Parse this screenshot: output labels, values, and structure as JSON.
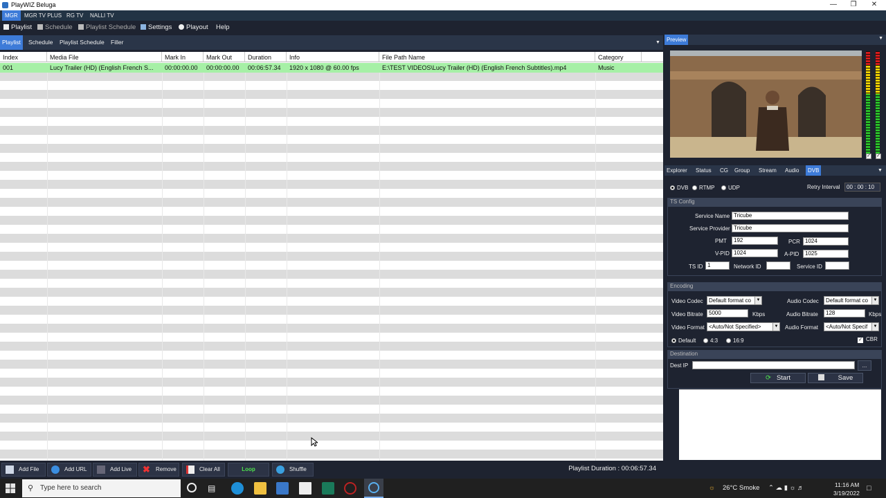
{
  "window": {
    "title": "PlayWIZ Beluga"
  },
  "channel_tabs": [
    "MGR",
    "MGR TV PLUS",
    "RG TV",
    "NALLI TV"
  ],
  "menu": {
    "items": [
      {
        "label": "Playlist"
      },
      {
        "label": "Schedule"
      },
      {
        "label": "Playlist Schedule"
      },
      {
        "label": "Settings"
      },
      {
        "label": "Playout"
      },
      {
        "label": "Help"
      }
    ]
  },
  "left_tabs": [
    "Playlist",
    "Schedule",
    "Playlist Schedule",
    "Filler"
  ],
  "playlist": {
    "columns": [
      "Index",
      "Media File",
      "Mark In",
      "Mark Out",
      "Duration",
      "Info",
      "File Path Name",
      "Category"
    ],
    "rows": [
      {
        "index": "001",
        "media_file": "Lucy Trailer (HD) (English French S...",
        "mark_in": "00:00:00.00",
        "mark_out": "00:00:00.00",
        "duration": "00:06:57.34",
        "info": "1920 x 1080 @ 60.00 fps",
        "path": "E:\\TEST VIDEOS\\Lucy Trailer (HD) (English French Subtitles).mp4",
        "category": "Music"
      }
    ]
  },
  "bottom_bar": {
    "buttons": [
      "Add File",
      "Add URL",
      "Add Live",
      "Remove",
      "Clear All",
      "Loop",
      "Shuffle"
    ],
    "duration_label": "Playlist Duration : 00:06:57.34"
  },
  "preview": {
    "label": "Preview"
  },
  "right_tabs": [
    "Explorer",
    "Status",
    "CG",
    "Group",
    "Stream",
    "Audio",
    "DVB"
  ],
  "dvb": {
    "modes": [
      "DVB",
      "RTMP",
      "UDP"
    ],
    "retry_label": "Retry Interval",
    "retry_value": "00 : 00 : 10",
    "ts_config": {
      "title": "TS Config",
      "service_name_label": "Service Name",
      "service_name": "Tricube",
      "service_provider_label": "Service Provider",
      "service_provider": "Tricube",
      "pmt_label": "PMT",
      "pmt": "192",
      "pcr_label": "PCR",
      "pcr": "1024",
      "vpid_label": "V-PID",
      "vpid": "1024",
      "apid_label": "A-PID",
      "apid": "1025",
      "tsid_label": "TS ID",
      "tsid": "1",
      "network_id_label": "Network ID",
      "network_id": "",
      "service_id_label": "Service ID",
      "service_id": ""
    },
    "encoding": {
      "title": "Encoding",
      "video_codec_label": "Video Codec",
      "video_codec": "Default format co",
      "audio_codec_label": "Audio Codec",
      "audio_codec": "Default format co",
      "video_bitrate_label": "Video Bitrate",
      "video_bitrate": "5000",
      "video_bitrate_unit": "Kbps",
      "audio_bitrate_label": "Audio Bitrate",
      "audio_bitrate": "128",
      "audio_bitrate_unit": "Kbps",
      "video_format_label": "Video Format",
      "video_format": "<Auto/Not Specified>",
      "audio_format_label": "Audio Format",
      "audio_format": "<Auto/Not Specif",
      "aspect": [
        "Default",
        "4:3",
        "16:9"
      ],
      "cbr_label": "CBR"
    },
    "destination": {
      "title": "Destination",
      "dest_ip_label": "Dest IP",
      "dest_ip": "",
      "browse_label": "...",
      "start_label": "Start",
      "save_label": "Save"
    }
  },
  "taskbar": {
    "search_placeholder": "Type here to search",
    "weather": "26°C  Smoke",
    "time": "11:16 AM",
    "date": "3/19/2022"
  },
  "colors": {
    "accent": "#3d7bd8",
    "selected_row": "#a6f0a6",
    "panel": "#1e2330"
  }
}
